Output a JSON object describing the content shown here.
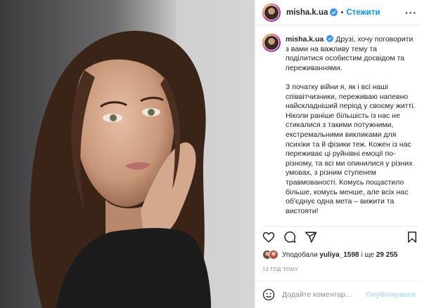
{
  "account": {
    "username": "misha.k.ua",
    "follow_label": "Стежити",
    "verified": true
  },
  "caption": {
    "username": "misha.k.ua",
    "paragraphs": [
      "Друзі, хочу поговорити з вами на важливу тему та поділитися особистим досвідом та переживаннями.",
      "З початку війни я, як і всі наші співвітчизники, переживаю напевно найскладніший період у своєму житті. Ніколи раніше більшість із нас не стикалися з такими потужними, екстремальними викликами для психіки та й фізики теж. Кожен із нас переживає ці руйнівні емоції по-різному, та всі ми опинилися у різних умовах, з різним ступенем травмованості. Комусь пощастило більше, комусь менше, але всіх нас об'єднує одна мета – вижити та вистояти!"
    ]
  },
  "likes": {
    "prefix": "Уподобали",
    "user": "yuliya_1598",
    "connector": "і ще",
    "count": "29 255"
  },
  "timestamp": "13 ГОД ТОМУ",
  "comment_box": {
    "placeholder": "Додайте коментар...",
    "publish_label": "Опублікувати"
  },
  "icons": [
    "more-icon",
    "verified-icon",
    "heart-icon",
    "comment-icon",
    "share-icon",
    "bookmark-icon",
    "emoji-icon"
  ],
  "colors": {
    "accent": "#0095f6",
    "publish_disabled": "#b3dbff",
    "muted": "#8e8e8e"
  }
}
